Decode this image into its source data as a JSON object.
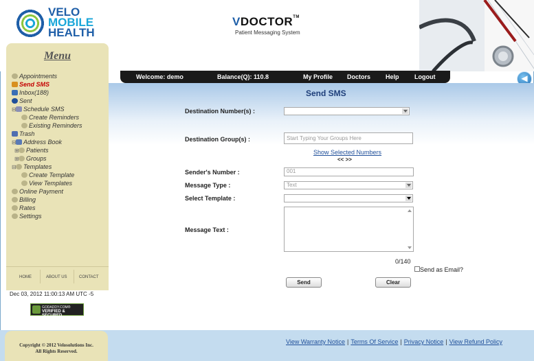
{
  "header": {
    "logo_line1": "VELO",
    "logo_line2": "MOBILE",
    "logo_line3": "HEALTH",
    "product_name": "DOCTOR",
    "product_prefix": "V",
    "product_tm": "TM",
    "product_subtitle": "Patient Messaging System"
  },
  "navbar": {
    "welcome": "Welcome: demo",
    "balance": "Balance(Q): 110.8",
    "my_profile": "My Profile",
    "doctors": "Doctors",
    "help": "Help",
    "logout": "Logout"
  },
  "sidebar": {
    "menu_title": "Menu",
    "items": [
      {
        "label": "Appointments"
      },
      {
        "label": "Send SMS"
      },
      {
        "label": "Inbox(188)"
      },
      {
        "label": "Sent"
      },
      {
        "label": "Schedule SMS"
      },
      {
        "label": "Create Reminders"
      },
      {
        "label": "Existing Reminders"
      },
      {
        "label": "Trash"
      },
      {
        "label": "Address Book"
      },
      {
        "label": "Patients"
      },
      {
        "label": "Groups"
      },
      {
        "label": "Templates"
      },
      {
        "label": "Create Template"
      },
      {
        "label": "View Templates"
      },
      {
        "label": "Online Payment"
      },
      {
        "label": "Billing"
      },
      {
        "label": "Rates"
      },
      {
        "label": "Settings"
      }
    ],
    "bottom_links": {
      "home": "HOME",
      "about": "ABOUT US",
      "contact": "CONTACT"
    },
    "datetime": "Dec 03, 2012 11:00:13 AM UTC -5",
    "badge_line1": "GODADDY.COM®",
    "badge_line2": "VERIFIED & SECURED",
    "badge_line3": "VERIFY SECURITY"
  },
  "form": {
    "heading": "Send SMS",
    "destination_numbers_label": "Destination Number(s) :",
    "destination_numbers_value": "",
    "destination_groups_label": "Destination Group(s) :",
    "destination_groups_placeholder": "Start Typing Your Groups Here",
    "show_selected_numbers": "Show Selected Numbers",
    "nav_arrows": "<< >>",
    "senders_number_label": "Sender's Number :",
    "senders_number_value": "001",
    "message_type_label": "Message Type :",
    "message_type_value": "Text",
    "select_template_label": "Select Template :",
    "select_template_value": "",
    "message_text_label": "Message Text :",
    "counter": "0/140",
    "send_as_email": "Send as Email?",
    "send_button": "Send",
    "clear_button": "Clear"
  },
  "footer": {
    "copyright_line1": "Copyright © 2012 Velosolutions Inc.",
    "copyright_line2": "All Rights Reserved.",
    "links": {
      "warranty": "View Warranty Notice",
      "terms": "Terms Of Service",
      "privacy": "Privacy Notice",
      "refund": "View Refund Policy"
    }
  },
  "colors": {
    "nav_bg": "#1a1a1a",
    "sidebar_bg": "#e9e3b7",
    "active_menu": "#c40000",
    "link": "#1f4f9a",
    "heading": "#1f3f7a"
  }
}
